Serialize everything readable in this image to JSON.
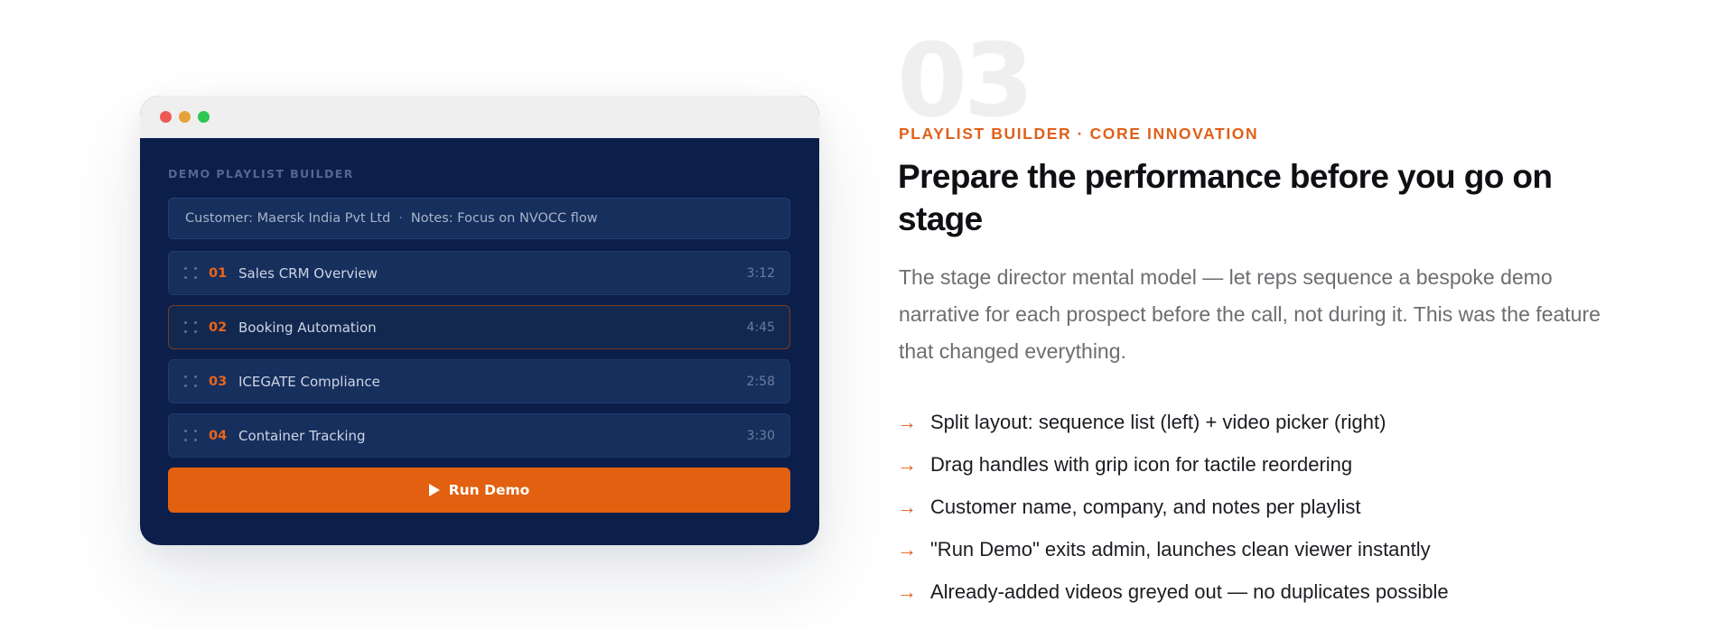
{
  "colors": {
    "accent": "#e2600f",
    "window_bg": "#0b1f4a",
    "dot_red": "#ed5a55",
    "dot_yellow": "#e6a33a",
    "dot_green": "#2fc654"
  },
  "mockup": {
    "builder_label": "DEMO PLAYLIST BUILDER",
    "customer": "Customer: Maersk India Pvt Ltd",
    "separator": "·",
    "notes": "Notes: Focus on NVOCC flow",
    "playlist": [
      {
        "num": "01",
        "title": "Sales CRM Overview",
        "duration": "3:12"
      },
      {
        "num": "02",
        "title": "Booking Automation",
        "duration": "4:45"
      },
      {
        "num": "03",
        "title": "ICEGATE Compliance",
        "duration": "2:58"
      },
      {
        "num": "04",
        "title": "Container Tracking",
        "duration": "3:30"
      }
    ],
    "run_label": "Run Demo",
    "icons": {
      "grip": "grip-icon",
      "play": "play-icon"
    }
  },
  "section": {
    "number": "03",
    "eyebrow": "PLAYLIST BUILDER · CORE INNOVATION",
    "headline": "Prepare the performance before you go on stage",
    "description": "The stage director mental model — let reps sequence a bespoke demo narrative for each prospect before the call, not during it. This was the feature that changed everything.",
    "arrow": "→",
    "features": [
      "Split layout: sequence list (left) + video picker (right)",
      "Drag handles with grip icon for tactile reordering",
      "Customer name, company, and notes per playlist",
      "\"Run Demo\" exits admin, launches clean viewer instantly",
      "Already-added videos greyed out — no duplicates possible"
    ]
  }
}
